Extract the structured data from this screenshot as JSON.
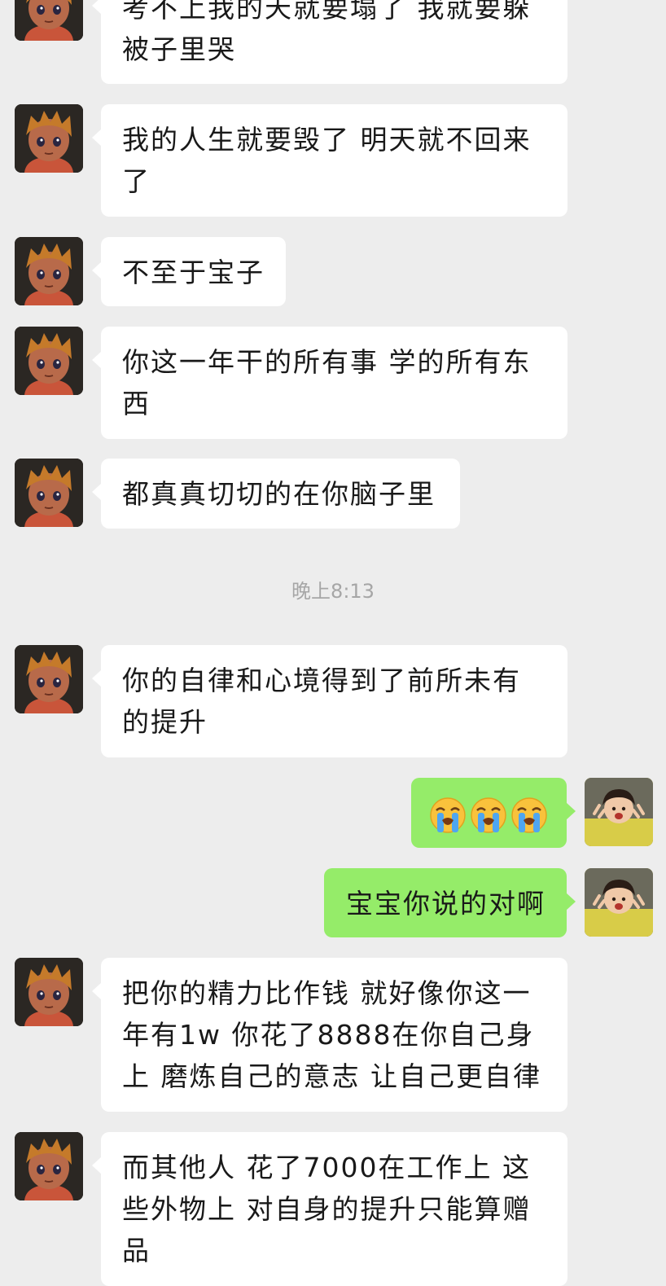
{
  "messages": [
    {
      "sender": "contact",
      "text": "考不上我的天就要塌了 我就要躲被子里哭"
    },
    {
      "sender": "contact",
      "text": "我的人生就要毁了 明天就不回来了"
    },
    {
      "sender": "contact",
      "text": "不至于宝子"
    },
    {
      "sender": "contact",
      "text": "你这一年干的所有事 学的所有东西"
    },
    {
      "sender": "contact",
      "text": "都真真切切的在你脑子里"
    },
    {
      "sender": "contact",
      "text": "你的自律和心境得到了前所未有的提升"
    },
    {
      "sender": "me",
      "text": "",
      "emojis": [
        "loudly-crying-face",
        "loudly-crying-face",
        "loudly-crying-face"
      ]
    },
    {
      "sender": "me",
      "text": "宝宝你说的对啊"
    },
    {
      "sender": "contact",
      "text": "把你的精力比作钱 就好像你这一年有1w 你花了8888在你自己身上 磨炼自己的意志 让自己更自律"
    },
    {
      "sender": "contact",
      "text": "而其他人 花了7000在工作上 这些外物上 对自身的提升只能算赠品"
    }
  ],
  "timestamp": "晚上8:13",
  "colors": {
    "background": "#ededed",
    "incoming_bubble": "#ffffff",
    "outgoing_bubble": "#95ec69",
    "timestamp_text": "#a6a6a6"
  }
}
